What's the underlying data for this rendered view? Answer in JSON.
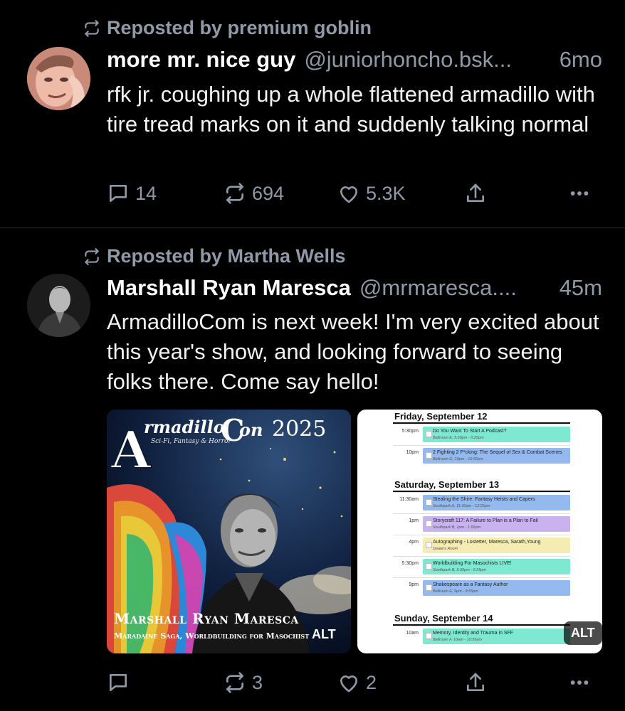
{
  "post1": {
    "repost_label": "Reposted by premium goblin",
    "name": "more mr. nice guy",
    "handle": "@juniorhoncho.bsk...",
    "time": "6mo",
    "text": "rfk jr. coughing up a whole flattened armadillo with tire tread marks on it and suddenly talking normal",
    "replies": "14",
    "reposts": "694",
    "likes": "5.3K"
  },
  "post2": {
    "repost_label": "Reposted by Martha Wells",
    "name": "Marshall Ryan Maresca",
    "handle": "@mrmaresca....",
    "time": "45m",
    "text": "ArmadilloCom is next week!  I'm very excited about this year's show, and looking forward to seeing folks there.  Come say hello!",
    "replies": "",
    "reposts": "3",
    "likes": "2",
    "image1": {
      "logo_word": "rmadillo",
      "logo_word2": "on",
      "logo_year": "2025",
      "logo_sub": "Sci-Fi, Fantasy & Horror",
      "caption_name": "Marshall Ryan Maresca",
      "caption_sub": "Maradaine Saga, Worldbuilding for Masochist",
      "alt": "ALT"
    },
    "image2": {
      "alt": "ALT",
      "days": [
        {
          "label": "Friday, September 12",
          "events": [
            {
              "time": "5:30pm",
              "title": "Do You Want To Start A Podcast?",
              "sub": "Ballroom E, 5:30pm - 6:25pm",
              "color": "#7fe8d0"
            },
            {
              "time": "10pm",
              "title": "2 Fighting 2 F*cking: The Sequel of Sex & Combat Scenes",
              "sub": "Ballroom G, 10pm - 10:55pm",
              "color": "#93b9ef"
            }
          ]
        },
        {
          "label": "Saturday, September 13",
          "events": [
            {
              "time": "11:30am",
              "title": "Stealing the Shire: Fantasy Heists and Capers",
              "sub": "Southpark A, 11:30am - 12:25pm",
              "color": "#93b9ef"
            },
            {
              "time": "1pm",
              "title": "Storycraft 117: A Failure to Plan is a Plan to Fail",
              "sub": "Southpark B, 1pm - 1:55pm",
              "color": "#c8b2f0"
            },
            {
              "time": "4pm",
              "title": "Autographing - Lostetter, Maresca, Sarath,Young",
              "sub": "Dealers Room",
              "color": "#f4ecb0"
            },
            {
              "time": "5:30pm",
              "title": "Worldbuilding For Masochists LIVE!",
              "sub": "Southpark B, 5:30pm - 6:25pm",
              "color": "#7fe8d0"
            },
            {
              "time": "9pm",
              "title": "Shakespeare as a Fantasy Author",
              "sub": "Ballroom E, 9pm - 9:55pm",
              "color": "#93b9ef"
            }
          ]
        },
        {
          "label": "Sunday, September 14",
          "events": [
            {
              "time": "10am",
              "title": "Memory, Identity and Trauma in SFF",
              "sub": "Ballroom F, 10am - 10:55am",
              "color": "#7fe8d0"
            }
          ]
        }
      ]
    }
  }
}
